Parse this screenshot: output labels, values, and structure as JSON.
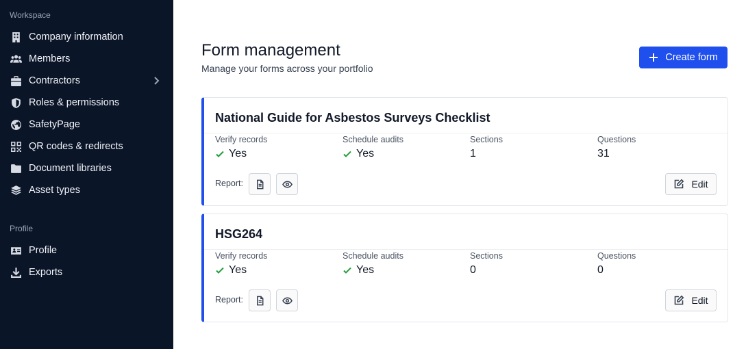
{
  "sidebar": {
    "workspace_title": "Workspace",
    "workspace_items": [
      {
        "label": "Company information",
        "icon": "building-icon"
      },
      {
        "label": "Members",
        "icon": "users-icon"
      },
      {
        "label": "Contractors",
        "icon": "briefcase-icon"
      },
      {
        "label": "Roles & permissions",
        "icon": "shield-icon"
      },
      {
        "label": "SafetyPage",
        "icon": "globe-icon"
      },
      {
        "label": "QR codes & redirects",
        "icon": "qr-code-icon"
      },
      {
        "label": "Document libraries",
        "icon": "folder-icon"
      },
      {
        "label": "Asset types",
        "icon": "layers-icon"
      }
    ],
    "profile_title": "Profile",
    "profile_items": [
      {
        "label": "Profile",
        "icon": "id-card-icon"
      },
      {
        "label": "Exports",
        "icon": "download-icon"
      }
    ]
  },
  "header": {
    "title": "Form management",
    "subtitle": "Manage your forms across your portfolio",
    "create_label": "Create form"
  },
  "forms": [
    {
      "title": "National Guide for Asbestos Surveys Checklist",
      "verify_label": "Verify records",
      "verify_value": "Yes",
      "schedule_label": "Schedule audits",
      "schedule_value": "Yes",
      "sections_label": "Sections",
      "sections_value": "1",
      "questions_label": "Questions",
      "questions_value": "31",
      "report_label": "Report:",
      "edit_label": "Edit"
    },
    {
      "title": "HSG264",
      "verify_label": "Verify records",
      "verify_value": "Yes",
      "schedule_label": "Schedule audits",
      "schedule_value": "Yes",
      "sections_label": "Sections",
      "sections_value": "0",
      "questions_label": "Questions",
      "questions_value": "0",
      "report_label": "Report:",
      "edit_label": "Edit"
    }
  ],
  "colors": {
    "sidebar_bg": "#0b1528",
    "accent": "#1f4fec",
    "check": "#1f9d3a"
  }
}
